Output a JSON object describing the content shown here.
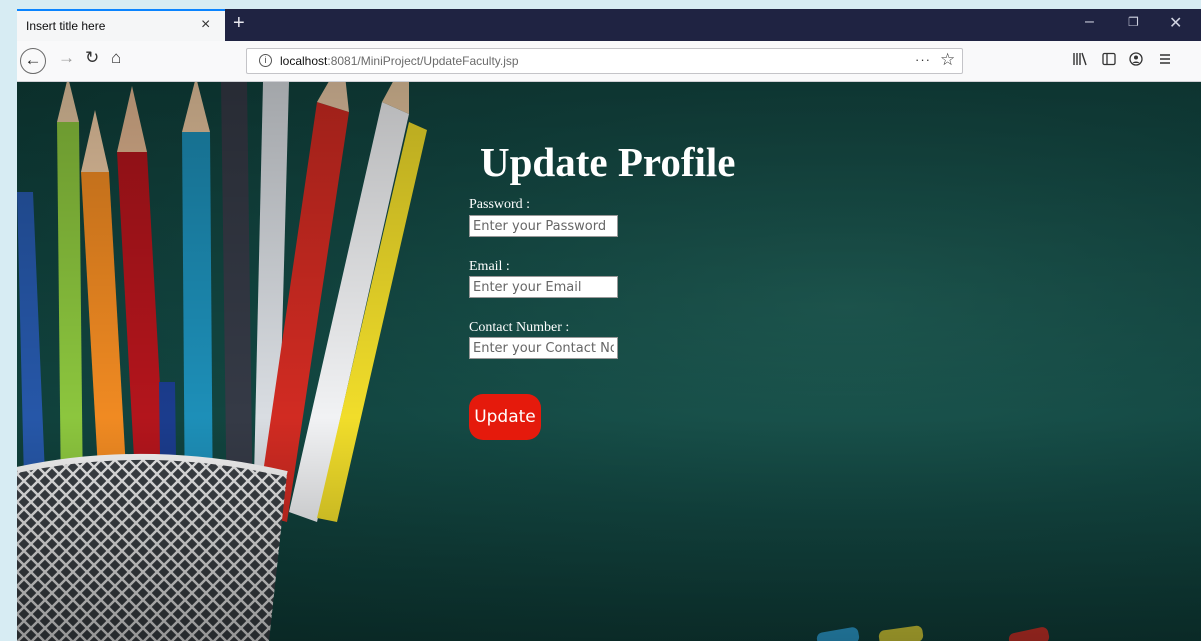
{
  "browser": {
    "tab_title": "Insert title here",
    "tab_close": "×",
    "new_tab": "+",
    "url_host": "localhost",
    "url_rest": ":8081/MiniProject/UpdateFaculty.jsp",
    "url_more": "···",
    "window_min": "–",
    "window_max": "❐",
    "window_close": "✕",
    "icons": [
      "back-arrow-icon",
      "forward-arrow-icon",
      "reload-icon",
      "home-icon",
      "info-icon",
      "bookmark-star-icon",
      "library-icon",
      "sidebar-icon",
      "account-icon",
      "menu-icon"
    ]
  },
  "page": {
    "title": "Update Profile",
    "fields": [
      {
        "label": "Password :",
        "placeholder": "Enter your Password"
      },
      {
        "label": "Email :",
        "placeholder": "Enter your Email"
      },
      {
        "label": "Contact Number :",
        "placeholder": "Enter your Contact No"
      }
    ],
    "submit_label": "Update"
  },
  "colors": {
    "background": "#134843",
    "button": "#e51a0c",
    "tab_strip": "#1f2342"
  }
}
